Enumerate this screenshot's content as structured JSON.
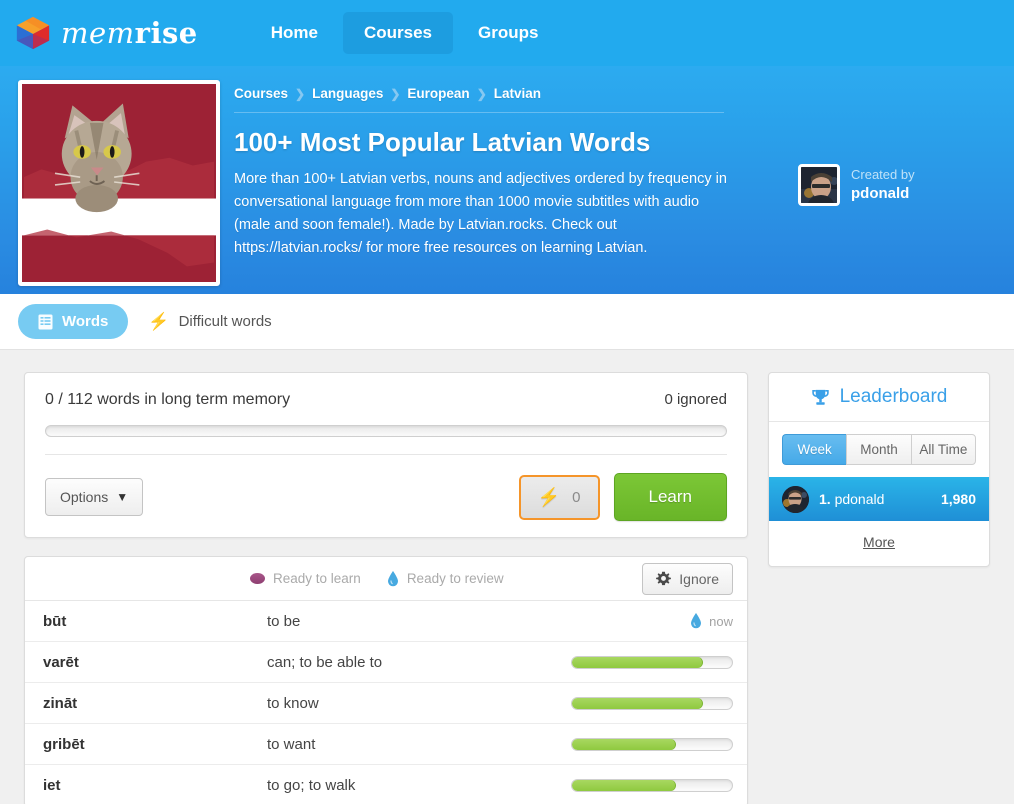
{
  "nav": {
    "brand_mem": "mem",
    "brand_rise": "rise",
    "links": [
      {
        "label": "Home",
        "active": false
      },
      {
        "label": "Courses",
        "active": true
      },
      {
        "label": "Groups",
        "active": false
      }
    ]
  },
  "course": {
    "breadcrumb": [
      "Courses",
      "Languages",
      "European",
      "Latvian"
    ],
    "title": "100+ Most Popular Latvian Words",
    "description": "More than 100+ Latvian verbs, nouns and adjectives ordered by frequency in conversational language from more than 1000 movie subtitles with audio (male and soon female!). Made by Latvian.rocks. Check out https://latvian.rocks/ for more free resources on learning Latvian.",
    "created_by_label": "Created by",
    "creator_name": "pdonald"
  },
  "tabs": [
    {
      "label": "Words",
      "icon": "list-icon",
      "active": true
    },
    {
      "label": "Difficult words",
      "icon": "bolt-icon",
      "active": false
    }
  ],
  "progress": {
    "summary": "0 / 112 words in long term memory",
    "ignored": "0 ignored",
    "percent": 0,
    "options_label": "Options",
    "points_value": "0",
    "learn_label": "Learn"
  },
  "words_panel": {
    "legend": [
      {
        "label": "Ready to learn",
        "icon": "oval-purple-icon"
      },
      {
        "label": "Ready to review",
        "icon": "water-drop-icon"
      }
    ],
    "ignore_label": "Ignore",
    "rows": [
      {
        "term": "būt",
        "definition": "to be",
        "status": "now",
        "status_icon": "water-drop-icon",
        "percent": null
      },
      {
        "term": "varēt",
        "definition": "can; to be able to",
        "status": "",
        "status_icon": "",
        "percent": 82
      },
      {
        "term": "zināt",
        "definition": "to know",
        "status": "",
        "status_icon": "",
        "percent": 82
      },
      {
        "term": "gribēt",
        "definition": "to want",
        "status": "",
        "status_icon": "",
        "percent": 65
      },
      {
        "term": "iet",
        "definition": "to go; to walk",
        "status": "",
        "status_icon": "",
        "percent": 65
      }
    ]
  },
  "leaderboard": {
    "title": "Leaderboard",
    "ranges": [
      {
        "label": "Week",
        "active": true
      },
      {
        "label": "Month",
        "active": false
      },
      {
        "label": "All Time",
        "active": false
      }
    ],
    "entries": [
      {
        "rank": "1.",
        "name": "pdonald",
        "score": "1,980"
      }
    ],
    "more_label": "More"
  },
  "colors": {
    "brand_blue": "#22aaee",
    "header_blue": "#2aa0ea",
    "learn_green": "#7cc736",
    "accent_orange": "#f5952a",
    "flag_red": "#a52340"
  }
}
